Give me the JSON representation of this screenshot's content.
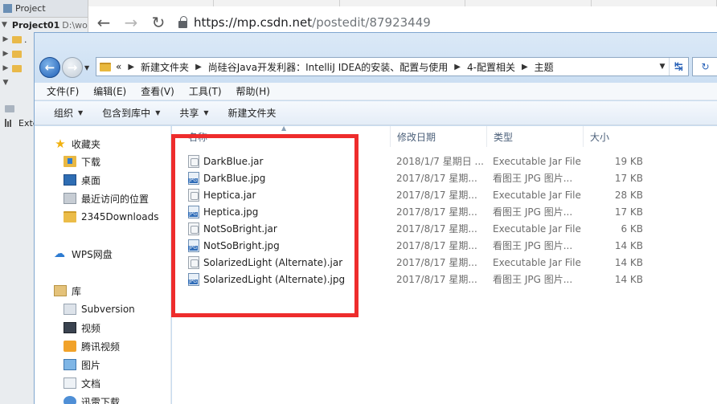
{
  "ide": {
    "header": "Project",
    "project_name": "Project01",
    "project_path": "D:\\work",
    "tree_stub": ".",
    "ext_label": "Exte"
  },
  "browser": {
    "url_host": "https://mp.csdn.net",
    "url_path": "/postedit/87923449"
  },
  "explorer": {
    "breadcrumb_prefix": "«",
    "breadcrumbs": [
      "新建文件夹",
      "尚硅谷Java开发利器：IntelliJ IDEA的安装、配置与使用",
      "4-配置相关",
      "主题"
    ],
    "menu": [
      "文件(F)",
      "编辑(E)",
      "查看(V)",
      "工具(T)",
      "帮助(H)"
    ],
    "toolbar": {
      "organize": "组织",
      "include_in_library": "包含到库中",
      "share": "共享",
      "new_folder": "新建文件夹"
    },
    "nav": {
      "favorites": "收藏夹",
      "downloads": "下载",
      "desktop": "桌面",
      "recent": "最近访问的位置",
      "downloads2345": "2345Downloads",
      "wps": "WPS网盘",
      "library": "库",
      "subversion": "Subversion",
      "videos": "视频",
      "tencent_video": "腾讯视频",
      "pictures": "图片",
      "documents": "文档",
      "xunlei": "迅雷下载"
    },
    "columns": {
      "name": "名称",
      "date": "修改日期",
      "type": "类型",
      "size": "大小"
    },
    "files": [
      {
        "name": "DarkBlue.jar",
        "icon": "jar",
        "date": "2018/1/7 星期日 ...",
        "type": "Executable Jar File",
        "size": "19 KB"
      },
      {
        "name": "DarkBlue.jpg",
        "icon": "jpg",
        "date": "2017/8/17 星期...",
        "type": "看图王 JPG 图片...",
        "size": "17 KB"
      },
      {
        "name": "Heptica.jar",
        "icon": "jar",
        "date": "2017/8/17 星期...",
        "type": "Executable Jar File",
        "size": "28 KB"
      },
      {
        "name": "Heptica.jpg",
        "icon": "jpg",
        "date": "2017/8/17 星期...",
        "type": "看图王 JPG 图片...",
        "size": "17 KB"
      },
      {
        "name": "NotSoBright.jar",
        "icon": "jar",
        "date": "2017/8/17 星期...",
        "type": "Executable Jar File",
        "size": "6 KB"
      },
      {
        "name": "NotSoBright.jpg",
        "icon": "jpg",
        "date": "2017/8/17 星期...",
        "type": "看图王 JPG 图片...",
        "size": "14 KB"
      },
      {
        "name": "SolarizedLight (Alternate).jar",
        "icon": "jar",
        "date": "2017/8/17 星期...",
        "type": "Executable Jar File",
        "size": "14 KB"
      },
      {
        "name": "SolarizedLight (Alternate).jpg",
        "icon": "jpg",
        "date": "2017/8/17 星期...",
        "type": "看图王 JPG 图片...",
        "size": "14 KB"
      }
    ],
    "highlight_color": "#ee2c2c"
  }
}
